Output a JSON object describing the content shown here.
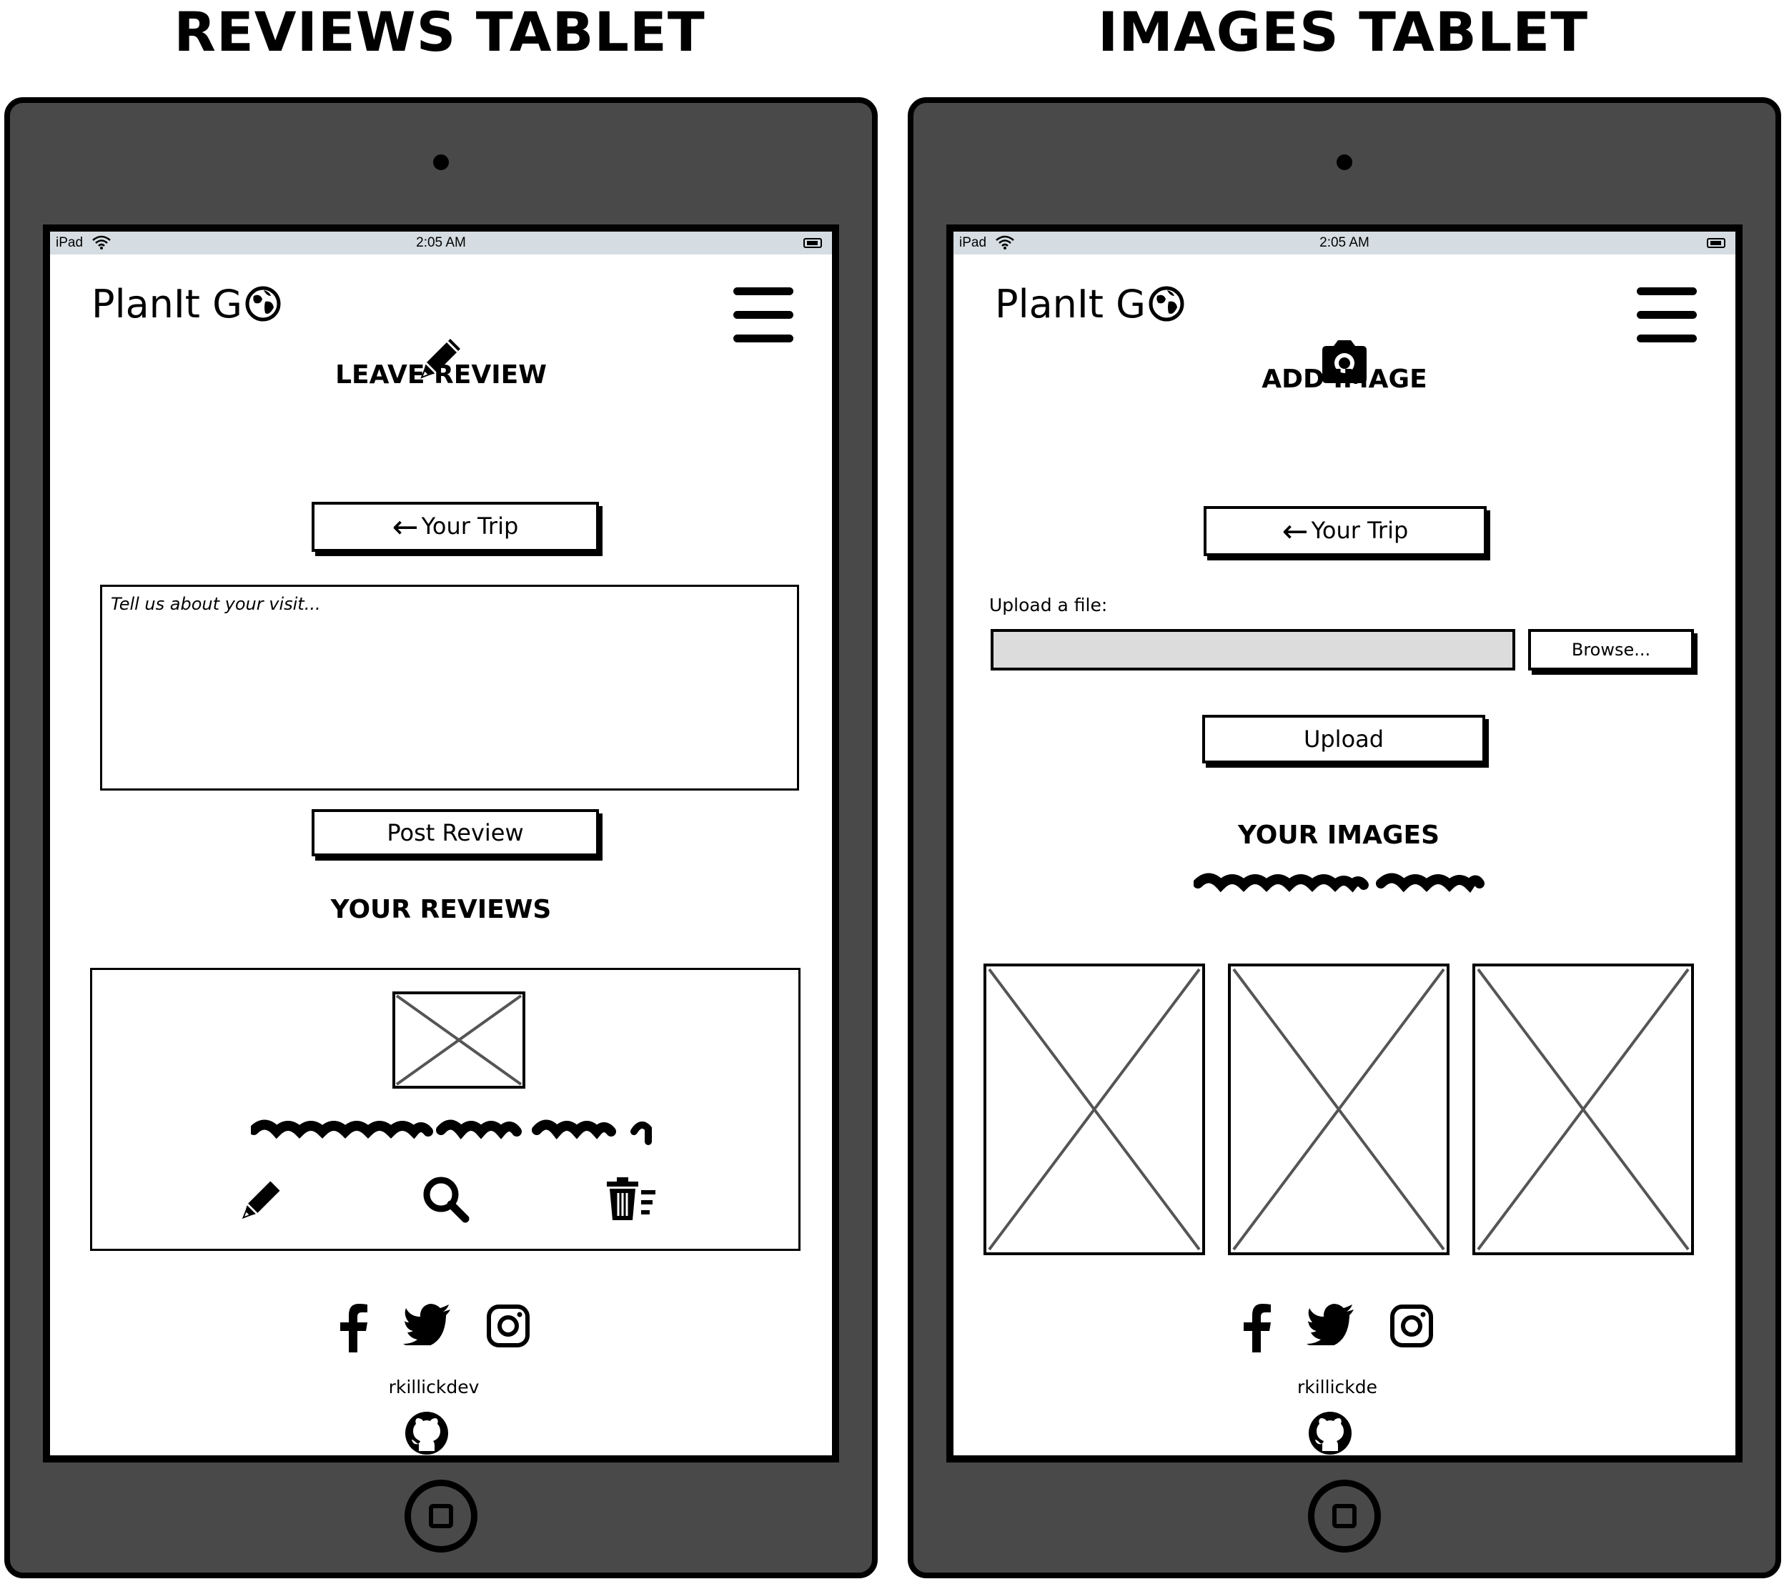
{
  "panels": [
    {
      "heading": "REVIEWS TABLET",
      "status": {
        "carrier": "iPad",
        "time": "2:05 AM"
      },
      "brand": "PlanIt G",
      "section_title": "LEAVE REVIEW",
      "back_button": "Your Trip",
      "review_placeholder": "Tell us about your visit...",
      "post_button": "Post Review",
      "list_title": "YOUR REVIEWS",
      "card_actions": [
        "pencil-icon",
        "search-icon",
        "trash-icon"
      ],
      "social_handle": "rkillickdev"
    },
    {
      "heading": "IMAGES TABLET",
      "status": {
        "carrier": "iPad",
        "time": "2:05 AM"
      },
      "brand": "PlanIt G",
      "section_title": "ADD IMAGE",
      "back_button": "Your Trip",
      "upload_label": "Upload a file:",
      "browse_button": "Browse...",
      "upload_button": "Upload",
      "list_title": "YOUR IMAGES",
      "image_placeholders": 3,
      "social_handle": "rkillickde"
    }
  ]
}
